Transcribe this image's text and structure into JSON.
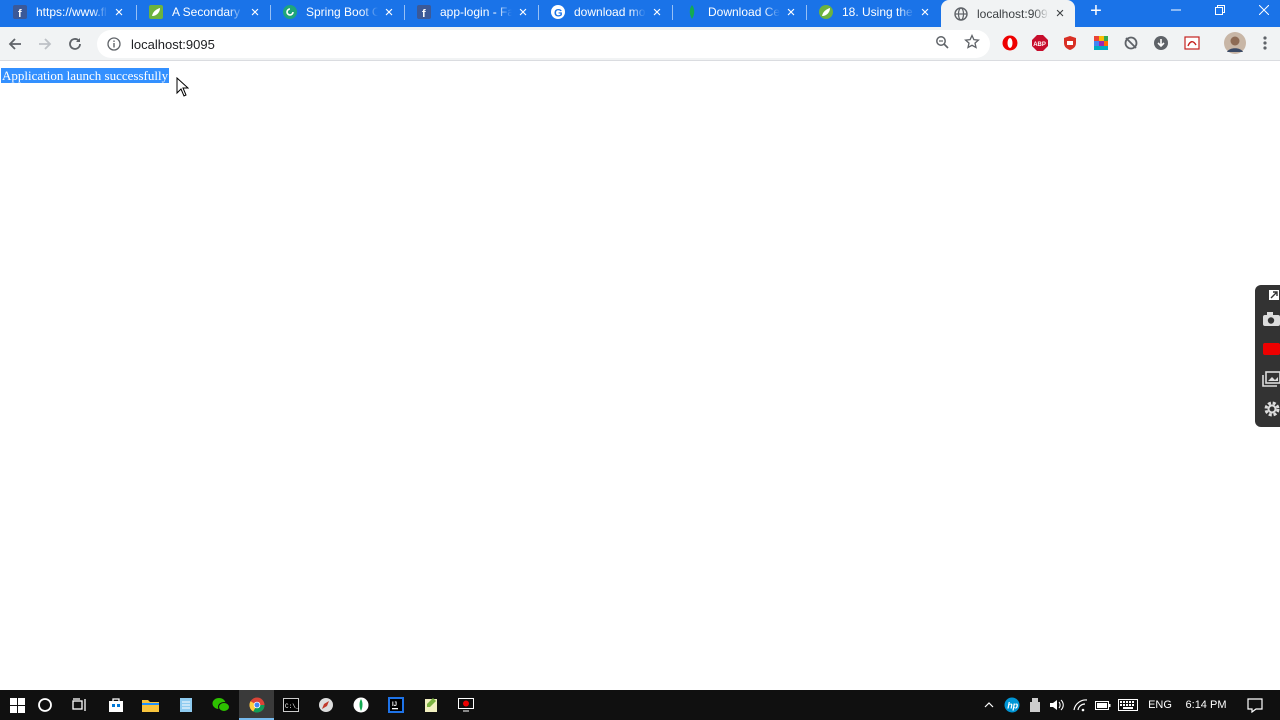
{
  "browser": {
    "tabs": [
      {
        "title": "https://www.fl",
        "icon": "facebook-icon",
        "active": false
      },
      {
        "title": "A Secondary F",
        "icon": "spring-leaf-icon",
        "active": false
      },
      {
        "title": "Spring Boot O",
        "icon": "refresh-green-icon",
        "active": false
      },
      {
        "title": "app-login - Fa",
        "icon": "facebook-icon",
        "active": false
      },
      {
        "title": "download mo",
        "icon": "google-icon",
        "active": false
      },
      {
        "title": "Download Cen",
        "icon": "mongodb-leaf-icon",
        "active": false
      },
      {
        "title": "18. Using the",
        "icon": "spring-leaf-icon",
        "active": false
      },
      {
        "title": "localhost:9095",
        "icon": "globe-icon",
        "active": true
      }
    ],
    "address_bar": {
      "url": "localhost:9095"
    }
  },
  "page": {
    "message": "Application launch successfully"
  },
  "taskbar": {
    "language": "ENG",
    "time": "6:14 PM"
  },
  "colors": {
    "tab_strip": "#1a73e8",
    "toolbar": "#f1f3f4",
    "selection": "#3390ff",
    "taskbar": "#101010"
  }
}
